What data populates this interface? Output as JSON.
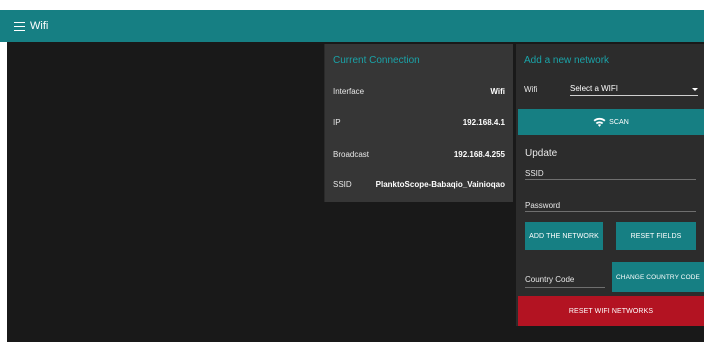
{
  "app": {
    "title": "Wifi"
  },
  "current_connection": {
    "title": "Current Connection",
    "rows": [
      {
        "label": "Interface",
        "value": "Wifi"
      },
      {
        "label": "IP",
        "value": "192.168.4.1"
      },
      {
        "label": "Broadcast",
        "value": "192.168.4.255"
      },
      {
        "label": "SSID",
        "value": "PlanktoScope-Babaqio_Vainioqao"
      }
    ]
  },
  "add_network": {
    "title": "Add a new network",
    "wifi_label": "Wifi",
    "wifi_select_value": "Select a WIFI",
    "scan_label": "SCAN",
    "update_title": "Update",
    "ssid_label": "SSID",
    "password_label": "Password",
    "add_button": "ADD THE NETWORK",
    "reset_fields_button": "RESET FIELDS",
    "country_code_label": "Country Code",
    "change_country_button": "CHANGE COUNTRY CODE",
    "reset_wifi_button": "RESET WIFI NETWORKS"
  },
  "colors": {
    "accent": "#167f83",
    "accent_text": "#1aa3a8",
    "danger": "#b31322",
    "panel": "#363636",
    "background": "#191919"
  },
  "icons": {
    "menu": "hamburger-menu-icon",
    "wifi": "wifi-icon",
    "dropdown": "caret-down-icon"
  }
}
